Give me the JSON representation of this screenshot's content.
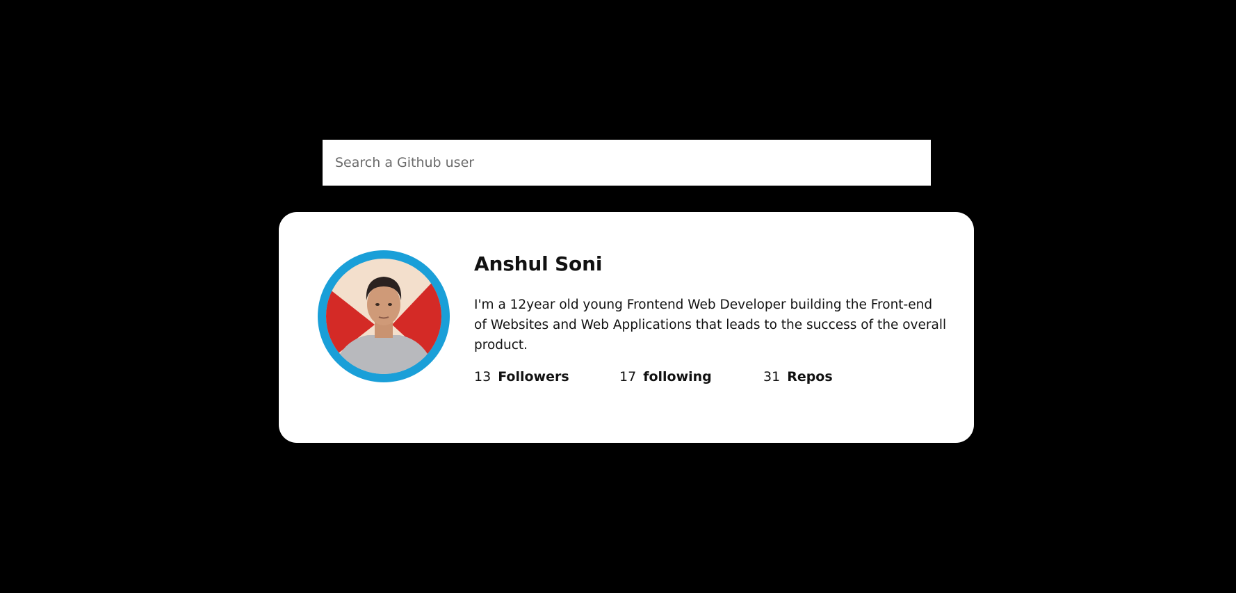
{
  "search": {
    "placeholder": "Search a Github user",
    "value": ""
  },
  "profile": {
    "avatar_icon": "user-avatar-photo",
    "name": "Anshul Soni",
    "bio": "I'm a 12year old young Frontend Web Developer building the Front-end of Websites and Web Applications that leads to the success of the overall product.",
    "stats": {
      "followers_count": "13",
      "followers_label": "Followers",
      "following_count": "17",
      "following_label": "following",
      "repos_count": "31",
      "repos_label": "Repos"
    }
  },
  "colors": {
    "background": "#000000",
    "card": "#ffffff",
    "avatar_ring": "#1a9fd8"
  }
}
